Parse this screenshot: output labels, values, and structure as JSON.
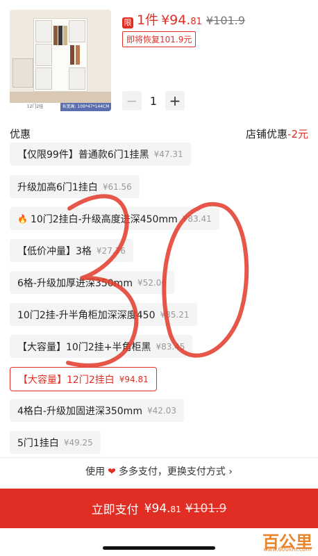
{
  "product": {
    "image_caption_left": "12门2挂",
    "image_caption_right": "长宽高: 109*47*144CM",
    "limit_label": "限",
    "limit_text": "1件",
    "price_main": "¥94.",
    "price_decimal": "81",
    "original_price": "¥101.9",
    "restore_text": "即将恢复101.9元"
  },
  "quantity": {
    "minus": "−",
    "value": "1",
    "plus": "+"
  },
  "discount": {
    "label": "优惠",
    "shop_label": "店铺优惠",
    "amount": "-2元"
  },
  "options": [
    {
      "name": "【仅限99件】普通款6门1挂黑",
      "price": "¥47.31"
    },
    {
      "name": "升级加高6门1挂白",
      "price": "¥61.56"
    },
    {
      "name": "10门2挂白-升级高度进深450mm",
      "price": "¥83.41",
      "hot": true
    },
    {
      "name": "【低价冲量】3格",
      "price": "¥27.76"
    },
    {
      "name": "6格-升级加厚进深350mm",
      "price": "¥52.06"
    },
    {
      "name": "10门2挂-升半角柜加深深度450",
      "price": "¥85.21"
    },
    {
      "name": "【大容量】10门2挂+半角柜黑",
      "price": "¥83.45"
    },
    {
      "name": "【大容量】12门2挂白",
      "price": "¥94.81",
      "selected": true
    },
    {
      "name": "4格白-升级加固进深350mm",
      "price": "¥42.03"
    },
    {
      "name": "5门1挂白",
      "price": "¥49.25"
    }
  ],
  "payment": {
    "use": "使用",
    "method": "多多支付，更换支付方式"
  },
  "pay_button": {
    "label": "立即支付",
    "price_main": "¥94.",
    "price_decimal": "81",
    "original": "¥101.9"
  },
  "watermark": {
    "text": "百公里",
    "sub": "www.600km.com"
  },
  "colors": {
    "accent": "#e02e24",
    "watermark": "#e8842b"
  },
  "icons": [
    "xian-badge-icon",
    "fire-icon",
    "heart-icon",
    "chevron-right-icon"
  ]
}
